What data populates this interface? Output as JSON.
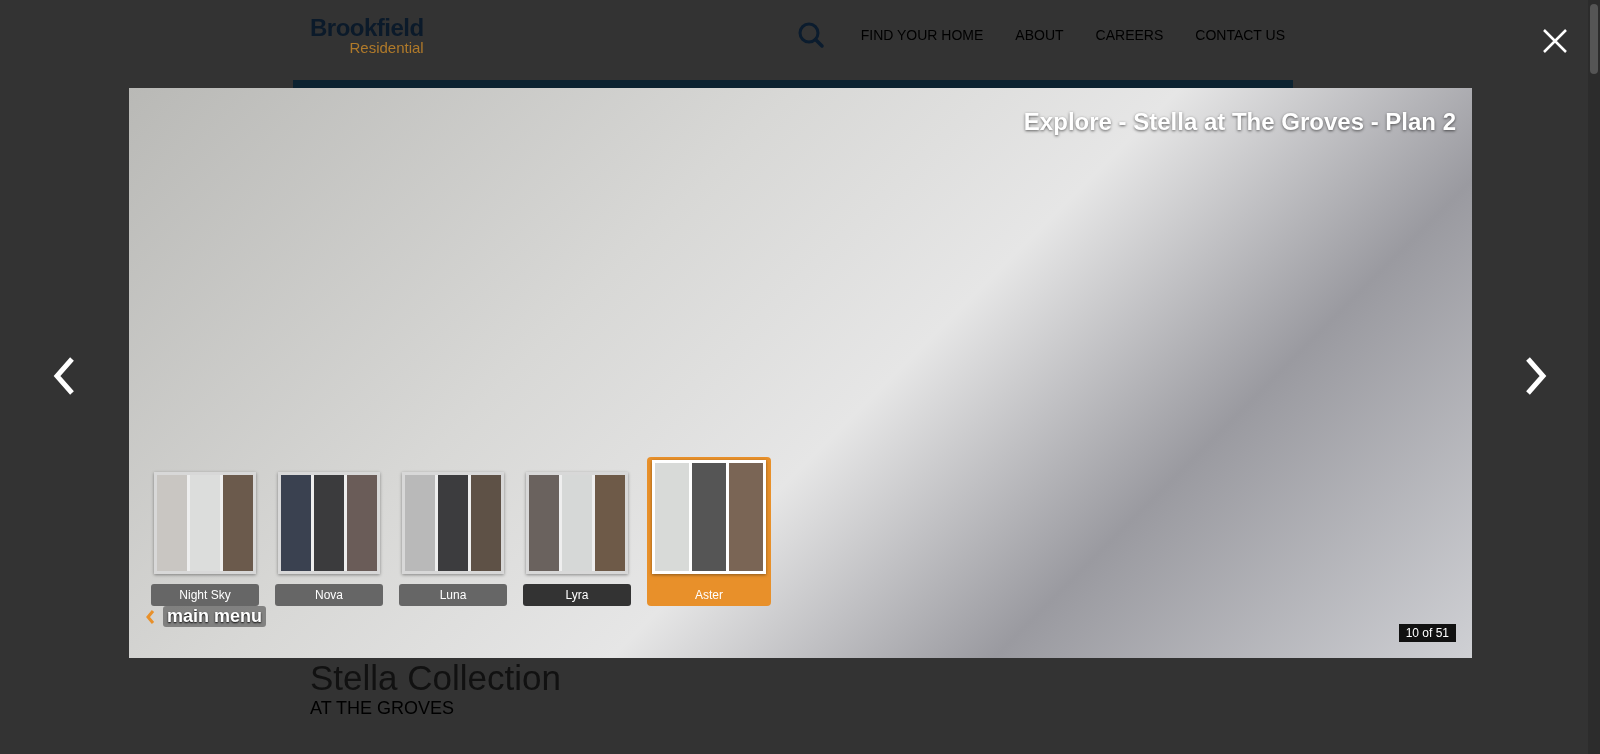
{
  "site": {
    "logo_top": "Brookfield",
    "logo_bottom": "Residential",
    "nav": [
      "FIND YOUR HOME",
      "ABOUT",
      "CAREERS",
      "CONTACT US"
    ]
  },
  "page": {
    "title": "Stella Collection",
    "subtitle": "AT THE GROVES"
  },
  "lightbox": {
    "title": "Explore - Stella at The Groves - Plan 2",
    "counter": "10 of 51",
    "back_label": "main menu",
    "swatches": [
      {
        "label": "Night Sky",
        "selected": false,
        "hovered": false
      },
      {
        "label": "Nova",
        "selected": false,
        "hovered": false
      },
      {
        "label": "Luna",
        "selected": false,
        "hovered": false
      },
      {
        "label": "Lyra",
        "selected": false,
        "hovered": true
      },
      {
        "label": "Aster",
        "selected": true,
        "hovered": false
      }
    ]
  }
}
